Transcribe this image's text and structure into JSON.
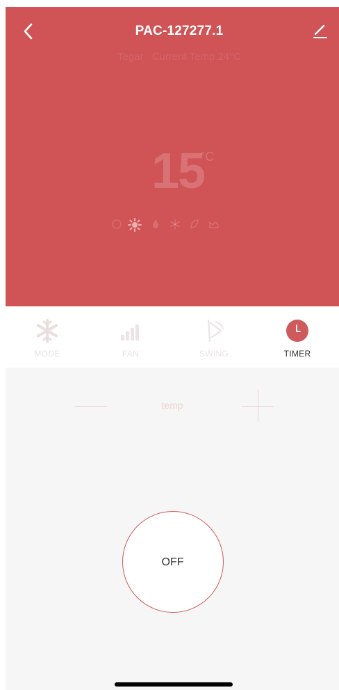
{
  "header": {
    "title": "PAC-127277.1",
    "back_icon": "chevron-left-icon",
    "edit_icon": "pencil-icon",
    "subtitle_prefix": "Tegar",
    "subtitle": "Current Temp 24°C",
    "hero_color": "#d05356"
  },
  "display": {
    "set_temp": "15",
    "unit": "°C",
    "status_icons": [
      "auto-mode-icon",
      "sun-icon",
      "drop-icon",
      "snowflake-icon",
      "leaf-icon",
      "fan-icon",
      "moon-icon"
    ],
    "active_status_icon": "sun-icon"
  },
  "tabs": [
    {
      "label": "MODE",
      "icon": "snowflake-icon",
      "active": false
    },
    {
      "label": "FAN",
      "icon": "fan-bars-icon",
      "active": false
    },
    {
      "label": "SWING",
      "icon": "swing-icon",
      "active": false
    },
    {
      "label": "TIMER",
      "icon": "clock-icon",
      "active": true
    }
  ],
  "controls": {
    "temp_label": "temp",
    "minus_icon": "minus-icon",
    "plus_icon": "plus-icon",
    "power_label": "OFF",
    "accent_color": "#cf5a5c"
  }
}
